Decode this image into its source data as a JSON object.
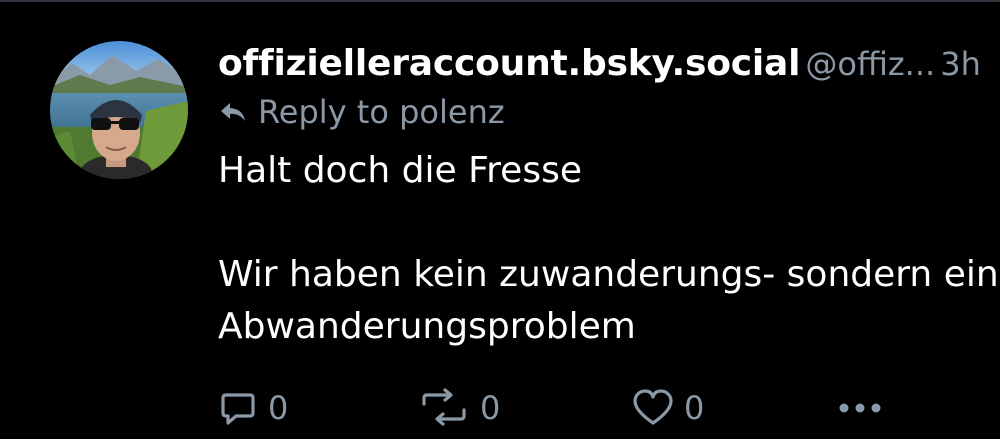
{
  "post": {
    "author": {
      "handle": "offizielleraccount.bsky.social",
      "username": "@offiz...",
      "timestamp": "3h"
    },
    "reply_to": "Reply to polenz",
    "text": "Halt doch die Fresse\n\nWir haben kein zuwanderungs- sondern ein Abwanderungsproblem",
    "stats": {
      "replies": "0",
      "reposts": "0",
      "likes": "0"
    }
  },
  "colors": {
    "background": "#000000",
    "text": "#ffffff",
    "muted": "#8b98a5",
    "divider": "#2e3440"
  },
  "icons": {
    "reply_to": "reply-arrow-icon",
    "reply": "speech-bubble-icon",
    "repost": "repost-icon",
    "like": "heart-icon",
    "more": "ellipsis-icon"
  }
}
